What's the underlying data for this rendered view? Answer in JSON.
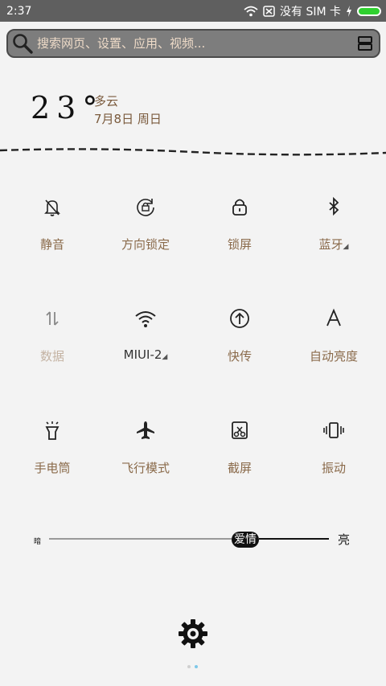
{
  "status_bar": {
    "time": "2:37",
    "carrier": "没有 SIM 卡"
  },
  "search": {
    "placeholder": "搜索网页、设置、应用、视频..."
  },
  "weather": {
    "temperature": "23°",
    "condition": "多云",
    "date": "7月8日 周日"
  },
  "tiles": [
    {
      "label": "静音",
      "icon": "bell-off-icon"
    },
    {
      "label": "方向锁定",
      "icon": "rotation-lock-icon"
    },
    {
      "label": "锁屏",
      "icon": "lock-icon"
    },
    {
      "label": "蓝牙",
      "icon": "bluetooth-icon"
    },
    {
      "label": "数据",
      "icon": "data-arrows-icon"
    },
    {
      "label": "MIUI-2",
      "icon": "wifi-icon"
    },
    {
      "label": "快传",
      "icon": "upload-circle-icon"
    },
    {
      "label": "自动亮度",
      "icon": "auto-brightness-icon"
    },
    {
      "label": "手电筒",
      "icon": "flashlight-icon"
    },
    {
      "label": "飞行模式",
      "icon": "airplane-icon"
    },
    {
      "label": "截屏",
      "icon": "screenshot-icon"
    },
    {
      "label": "振动",
      "icon": "vibrate-icon"
    }
  ],
  "brightness": {
    "dark_label": "暗",
    "bright_label": "亮",
    "thumb_label": "爱情",
    "level": 0.7
  },
  "pager": {
    "pages": 2,
    "current": 2
  },
  "colors": {
    "status_bar": "#5f5f5f",
    "battery": "#2fd02f",
    "label": "#8a6a4a",
    "pager_active": "#7ec8e8"
  }
}
